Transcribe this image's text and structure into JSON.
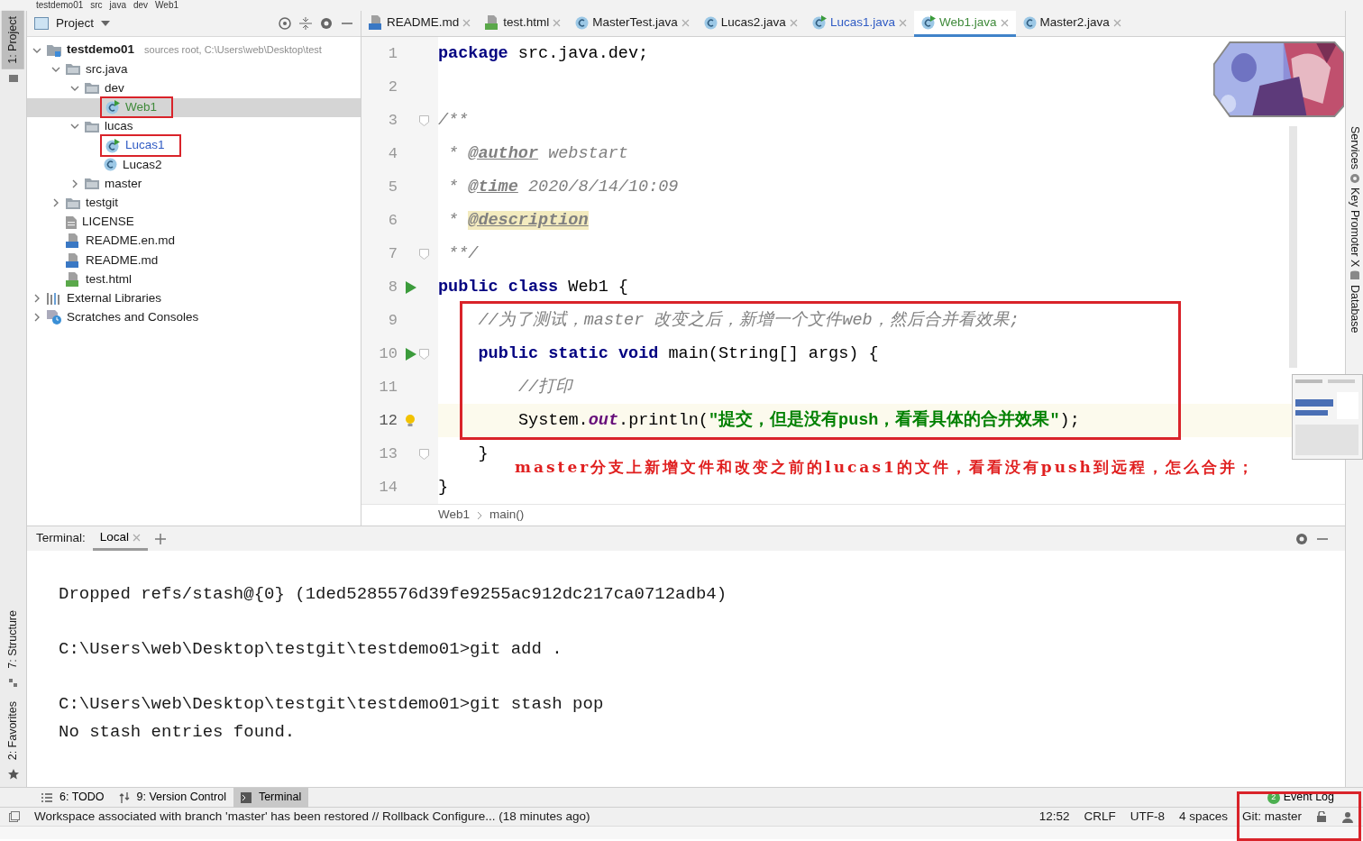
{
  "breadcrumb": [
    "testdemo01",
    "src",
    "java",
    "dev",
    "Web1"
  ],
  "left_stripe": [
    {
      "label": "1: Project",
      "selected": true
    },
    {
      "label": "7: Structure",
      "selected": false
    },
    {
      "label": "2: Favorites",
      "selected": false
    }
  ],
  "right_stripe": [
    "Services",
    "Key Promoter X",
    "Database"
  ],
  "project_panel": {
    "title": "Project",
    "tree": [
      {
        "label": "testdemo01",
        "hint": "sources root,  C:\\Users\\web\\Desktop\\test",
        "kind": "module",
        "color": "#1a1a1a",
        "selected": false,
        "boxed": false,
        "expanded": true,
        "children": [
          {
            "label": "src.java",
            "kind": "folder",
            "color": "#1a1a1a",
            "selected": false,
            "boxed": false,
            "expanded": true,
            "children": [
              {
                "label": "dev",
                "kind": "folder",
                "color": "#1a1a1a",
                "selected": false,
                "boxed": false,
                "expanded": true,
                "children": [
                  {
                    "label": "Web1",
                    "kind": "class-run",
                    "color": "#3f8a3a",
                    "selected": true,
                    "boxed": true
                  }
                ]
              },
              {
                "label": "lucas",
                "kind": "folder",
                "color": "#1a1a1a",
                "selected": false,
                "boxed": false,
                "expanded": true,
                "children": [
                  {
                    "label": "Lucas1",
                    "kind": "class-run",
                    "color": "#2f5bc4",
                    "selected": false,
                    "boxed": true
                  },
                  {
                    "label": "Lucas2",
                    "kind": "class",
                    "color": "#1a1a1a",
                    "selected": false,
                    "boxed": false
                  }
                ]
              },
              {
                "label": "master",
                "kind": "folder",
                "color": "#1a1a1a",
                "selected": false,
                "boxed": false,
                "expanded": false
              }
            ]
          },
          {
            "label": "testgit",
            "kind": "folder",
            "color": "#1a1a1a",
            "selected": false,
            "boxed": false,
            "expanded": false
          },
          {
            "label": "LICENSE",
            "kind": "file",
            "color": "#1a1a1a",
            "selected": false,
            "boxed": false
          },
          {
            "label": "README.en.md",
            "kind": "md",
            "color": "#1a1a1a",
            "selected": false,
            "boxed": false
          },
          {
            "label": "README.md",
            "kind": "md",
            "color": "#1a1a1a",
            "selected": false,
            "boxed": false
          },
          {
            "label": "test.html",
            "kind": "html",
            "color": "#1a1a1a",
            "selected": false,
            "boxed": false
          }
        ]
      },
      {
        "label": "External Libraries",
        "kind": "libraries",
        "color": "#1a1a1a",
        "selected": false,
        "boxed": false,
        "expanded": false
      },
      {
        "label": "Scratches and Consoles",
        "kind": "scratches",
        "color": "#1a1a1a",
        "selected": false,
        "boxed": false,
        "expanded": false
      }
    ]
  },
  "editor": {
    "tabs": [
      {
        "label": "README.md",
        "kind": "md",
        "color": "#1a1a1a",
        "selected": false
      },
      {
        "label": "test.html",
        "kind": "html",
        "color": "#1a1a1a",
        "selected": false
      },
      {
        "label": "MasterTest.java",
        "kind": "class",
        "color": "#1a1a1a",
        "selected": false
      },
      {
        "label": "Lucas2.java",
        "kind": "class",
        "color": "#1a1a1a",
        "selected": false
      },
      {
        "label": "Lucas1.java",
        "kind": "class-run",
        "color": "#2f5bc4",
        "selected": false
      },
      {
        "label": "Web1.java",
        "kind": "class-run",
        "color": "#3f8a3a",
        "selected": true
      },
      {
        "label": "Master2.java",
        "kind": "class",
        "color": "#1a1a1a",
        "selected": false
      }
    ],
    "lines": [
      {
        "number": "1",
        "kind": "plain",
        "current": false,
        "boxed": false,
        "tokens": [
          {
            "kind": "keyword",
            "text": "package"
          },
          {
            "kind": "plain",
            "text": " src.java.dev;"
          }
        ]
      },
      {
        "number": "2",
        "kind": "plain",
        "current": false,
        "boxed": false
      },
      {
        "number": "3",
        "kind": "fold",
        "current": false,
        "boxed": false,
        "tokens": [
          {
            "kind": "comment",
            "text": "/**"
          }
        ]
      },
      {
        "number": "4",
        "kind": "plain",
        "current": false,
        "boxed": false,
        "tokens": [
          {
            "kind": "comment",
            "text": " * "
          },
          {
            "kind": "doc-tag",
            "text": "@author"
          },
          {
            "kind": "comment",
            "text": " webstart"
          }
        ]
      },
      {
        "number": "5",
        "kind": "plain",
        "current": false,
        "boxed": false,
        "tokens": [
          {
            "kind": "comment",
            "text": " * "
          },
          {
            "kind": "doc-tag",
            "text": "@time"
          },
          {
            "kind": "comment",
            "text": " 2020/8/14/10:09"
          }
        ]
      },
      {
        "number": "6",
        "kind": "plain",
        "current": false,
        "boxed": false,
        "tokens": [
          {
            "kind": "comment",
            "text": " * "
          },
          {
            "kind": "doc-tag-found",
            "text": "@description"
          }
        ]
      },
      {
        "number": "7",
        "kind": "fold",
        "current": false,
        "boxed": false,
        "tokens": [
          {
            "kind": "comment",
            "text": " **/"
          }
        ]
      },
      {
        "number": "8",
        "kind": "run",
        "current": false,
        "boxed": false,
        "tokens": [
          {
            "kind": "keyword",
            "text": "public class"
          },
          {
            "kind": "plain",
            "text": " Web1 {"
          }
        ],
        "children": [
          {
            "number": "9",
            "kind": "plain",
            "current": false,
            "boxed": true,
            "tokens": [
              {
                "kind": "comment",
                "text": "//为了测试，master 改变之后，新增一个文件web，然后合并看效果;"
              }
            ]
          },
          {
            "number": "10",
            "kind": "run-fold",
            "current": false,
            "boxed": true,
            "tokens": [
              {
                "kind": "keyword",
                "text": "public static void"
              },
              {
                "kind": "plain",
                "text": " main(String[] args) {"
              }
            ],
            "children": [
              {
                "number": "11",
                "kind": "plain",
                "current": false,
                "boxed": true,
                "tokens": [
                  {
                    "kind": "comment",
                    "text": "//打印"
                  }
                ]
              },
              {
                "number": "12",
                "kind": "bulb",
                "current": true,
                "boxed": true,
                "tokens": [
                  {
                    "kind": "plain",
                    "text": "System."
                  },
                  {
                    "kind": "field",
                    "text": "out"
                  },
                  {
                    "kind": "plain",
                    "text": ".println("
                  },
                  {
                    "kind": "string",
                    "text": "\"提交，但是没有push，看看具体的合并效果\""
                  },
                  {
                    "kind": "plain",
                    "text": ");"
                  }
                ]
              }
            ]
          },
          {
            "number": "13",
            "kind": "fold",
            "current": false,
            "boxed": false,
            "tokens": [
              {
                "kind": "plain",
                "text": "}"
              }
            ]
          }
        ]
      },
      {
        "number": "14",
        "kind": "plain",
        "current": false,
        "boxed": false,
        "tokens": [
          {
            "kind": "plain",
            "text": "}"
          }
        ]
      }
    ],
    "annotation": "master分支上新增文件和改变之前的lucas1的文件，看看没有push到远程，怎么合并；",
    "breadcrumb": [
      "Web1",
      "main()"
    ]
  },
  "terminal": {
    "title": "Terminal:",
    "tabs": [
      {
        "label": "Local",
        "selected": true
      }
    ],
    "blocks": [
      [
        "Dropped refs/stash@{0} (1ded5285576d39fe9255ac912dc217ca0712adb4)"
      ],
      [
        "C:\\Users\\web\\Desktop\\testgit\\testdemo01>git add ."
      ],
      [
        "C:\\Users\\web\\Desktop\\testgit\\testdemo01>git stash pop",
        "No stash entries found."
      ]
    ]
  },
  "tool_tabs": [
    {
      "label": "6: TODO",
      "selected": false
    },
    {
      "label": "9: Version Control",
      "selected": false
    },
    {
      "label": "Terminal",
      "selected": true
    }
  ],
  "event_log": {
    "label": "Event Log",
    "count": "2"
  },
  "status_bar": {
    "message": "Workspace associated with branch 'master' has been restored // Rollback   Configure... (18 minutes ago)",
    "items": [
      "12:52",
      "CRLF",
      "UTF-8",
      "4 spaces",
      "Git: master"
    ],
    "boxed": true
  }
}
